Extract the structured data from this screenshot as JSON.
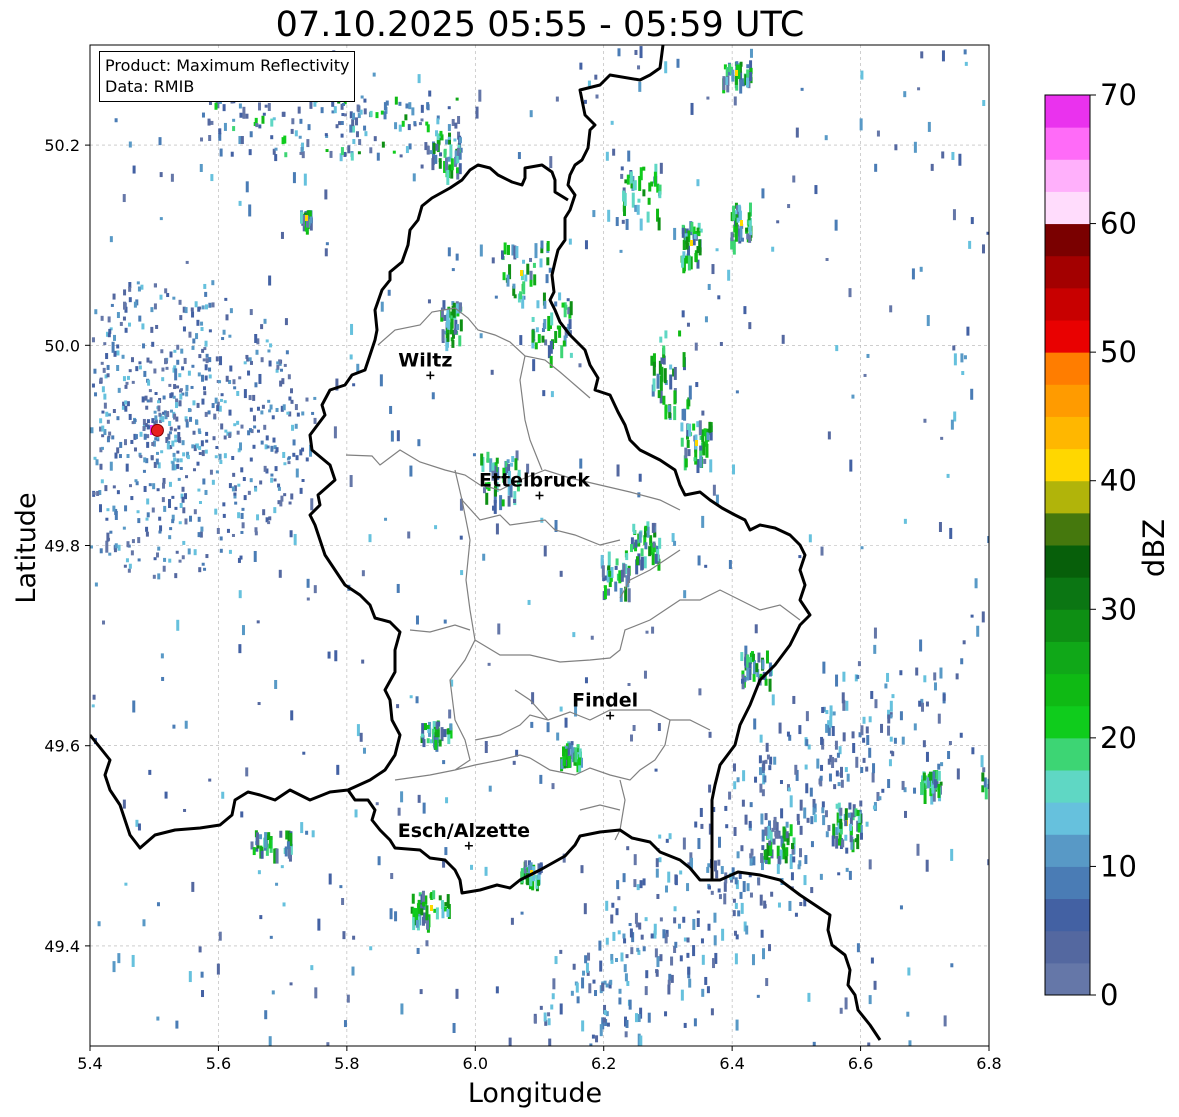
{
  "title": "07.10.2025 05:55 - 05:59 UTC",
  "info_box": {
    "product_line": "Product: Maximum Reflectivity",
    "data_line": "Data: RMIB"
  },
  "axes": {
    "xlabel": "Longitude",
    "ylabel": "Latitude",
    "xlim": [
      5.4,
      6.8
    ],
    "ylim": [
      49.3,
      50.3
    ],
    "xticks": [
      "5.4",
      "5.6",
      "5.8",
      "6.0",
      "6.2",
      "6.4",
      "6.6",
      "6.8"
    ],
    "yticks": [
      "49.4",
      "49.6",
      "49.8",
      "50.0",
      "50.2"
    ],
    "grid": true
  },
  "cities": [
    {
      "name": "Wiltz",
      "lon": 5.93,
      "lat": 49.97
    },
    {
      "name": "Ettelbruck",
      "lon": 6.1,
      "lat": 49.85
    },
    {
      "name": "Findel",
      "lon": 6.21,
      "lat": 49.63
    },
    {
      "name": "Esch/Alzette",
      "lon": 5.99,
      "lat": 49.5
    }
  ],
  "radar_site": {
    "lon": 5.505,
    "lat": 49.915,
    "color": "#e8201e"
  },
  "colorbar": {
    "label": "dBZ",
    "ticks": [
      "0",
      "10",
      "20",
      "30",
      "40",
      "50",
      "60",
      "70"
    ],
    "colors": [
      "#6577a8",
      "#5468a0",
      "#4361a3",
      "#4a7cb5",
      "#5899c6",
      "#66c1dd",
      "#5fd7c4",
      "#3dd574",
      "#0fcc1c",
      "#0fba14",
      "#10a818",
      "#0e8f14",
      "#0b7613",
      "#075f0a",
      "#45780d",
      "#b1b40a",
      "#ffd700",
      "#ffb700",
      "#ff9b00",
      "#ff7d00",
      "#e90101",
      "#c80000",
      "#a30000",
      "#7a0000",
      "#ffdcfc",
      "#ffb0fb",
      "#ff6bf8",
      "#ea32ee"
    ]
  }
}
